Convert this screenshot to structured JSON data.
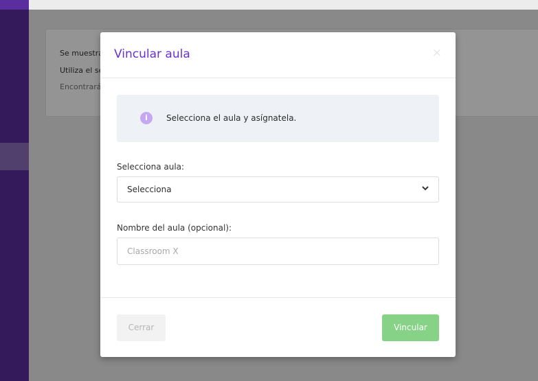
{
  "background": {
    "line1": "Se muestran las aulas en todos los idiomas.",
    "line2": "Utiliza el selector de idioma.",
    "line3": "Encontrarás ayuda en la guía."
  },
  "modal": {
    "title": "Vincular aula",
    "close_symbol": "×",
    "info_icon": "i",
    "info_text": "Selecciona el aula y asígnatela.",
    "select_label": "Selecciona aula:",
    "select_value": "Selecciona",
    "name_label": "Nombre del aula (opcional):",
    "name_placeholder": "Classroom X",
    "close_label": "Cerrar",
    "link_label": "Vincular"
  },
  "colors": {
    "sidebar": "#5a2e9e",
    "title": "#6b2fd0",
    "info_icon": "#c4a9f2",
    "primary_button": "#86d287"
  }
}
